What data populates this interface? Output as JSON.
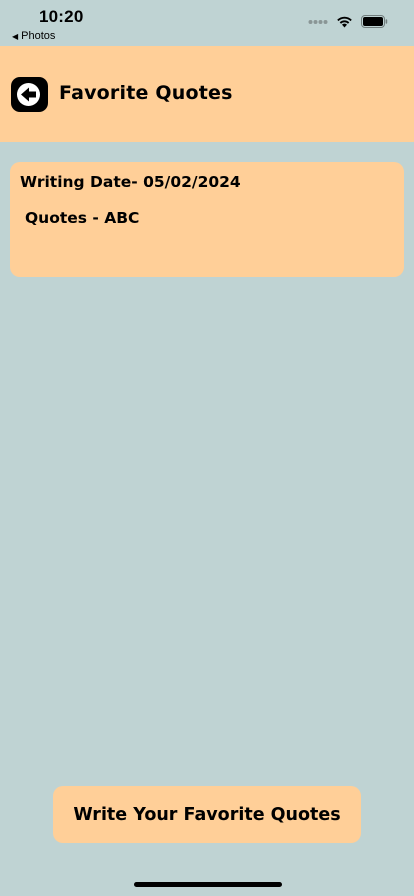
{
  "status_bar": {
    "time": "10:20",
    "back_app": "Photos",
    "icons": [
      "signal-dots-icon",
      "wifi-icon",
      "battery-icon"
    ]
  },
  "header": {
    "title": "Favorite Quotes",
    "back_icon": "arrow-left-icon"
  },
  "quotes": [
    {
      "date": "Writing Date- 05/02/2024",
      "text": "Quotes - ABC"
    }
  ],
  "footer": {
    "write_button_label": "Write Your Favorite Quotes"
  },
  "colors": {
    "background": "#BFD3D3",
    "accent": "#FFCF98",
    "text": "#000000"
  }
}
